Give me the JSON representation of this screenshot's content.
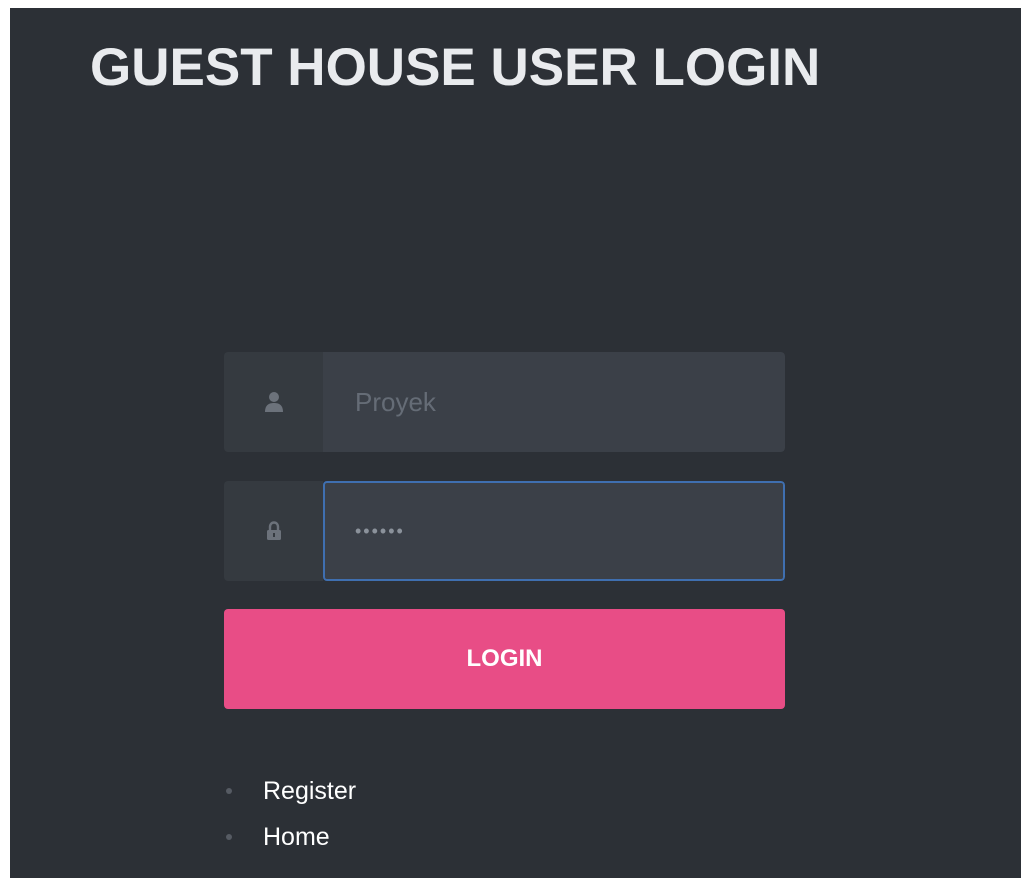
{
  "header": {
    "top_stub_text": "",
    "title": "GUEST HOUSE USER LOGIN"
  },
  "login_form": {
    "username": {
      "icon": "user-icon",
      "placeholder": "Proyek",
      "value": ""
    },
    "password": {
      "icon": "lock-icon",
      "value": "••••••",
      "focused": true
    },
    "submit_label": "LOGIN"
  },
  "links": [
    {
      "label": "Register"
    },
    {
      "label": "Home"
    }
  ],
  "colors": {
    "background": "#2c3036",
    "input_addon": "#353a40",
    "input_field": "#3b4048",
    "focus_border": "#3f6fb0",
    "button": "#e84d86",
    "title_text": "#e9ebee"
  }
}
